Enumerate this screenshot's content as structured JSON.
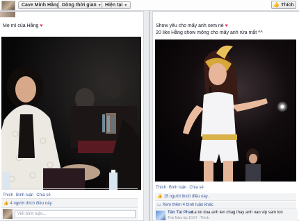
{
  "topbar": {
    "crumbs": [
      {
        "label": "Cave Minh Hằng"
      },
      {
        "label": "Dòng thời gian"
      },
      {
        "label": "Hiện tại"
      }
    ],
    "like_button": "Thích"
  },
  "left_post": {
    "caption": "Mẹ mì của Hằng",
    "actions": {
      "like": "Thích",
      "comment": "Bình luận",
      "share": "Chia sẻ"
    },
    "likes": "4 người thích điều này.",
    "comment_placeholder": "Viết bình luận..."
  },
  "right_post": {
    "caption_line1": "Show yêu cho mấy anh xem nè",
    "caption_line2": "20 like Hằng show mông cho mấy anh rửa mắt ^^",
    "actions": {
      "like": "Thích",
      "comment": "Bình luận",
      "share": "Chia sẻ"
    },
    "likes": "15 người thích điều này.",
    "more_comments": "Xem thêm 4 bình luận khác",
    "comment": {
      "author": "Tấn Tài Phan",
      "text": "La toi dua anh len chag thay anh nao vip sam lon",
      "meta": "Thứ Năm lúc 10:57 · Thích"
    }
  },
  "colors": {
    "link": "#3b5998",
    "heart": "#e8335a",
    "background": "#e9ebee"
  }
}
